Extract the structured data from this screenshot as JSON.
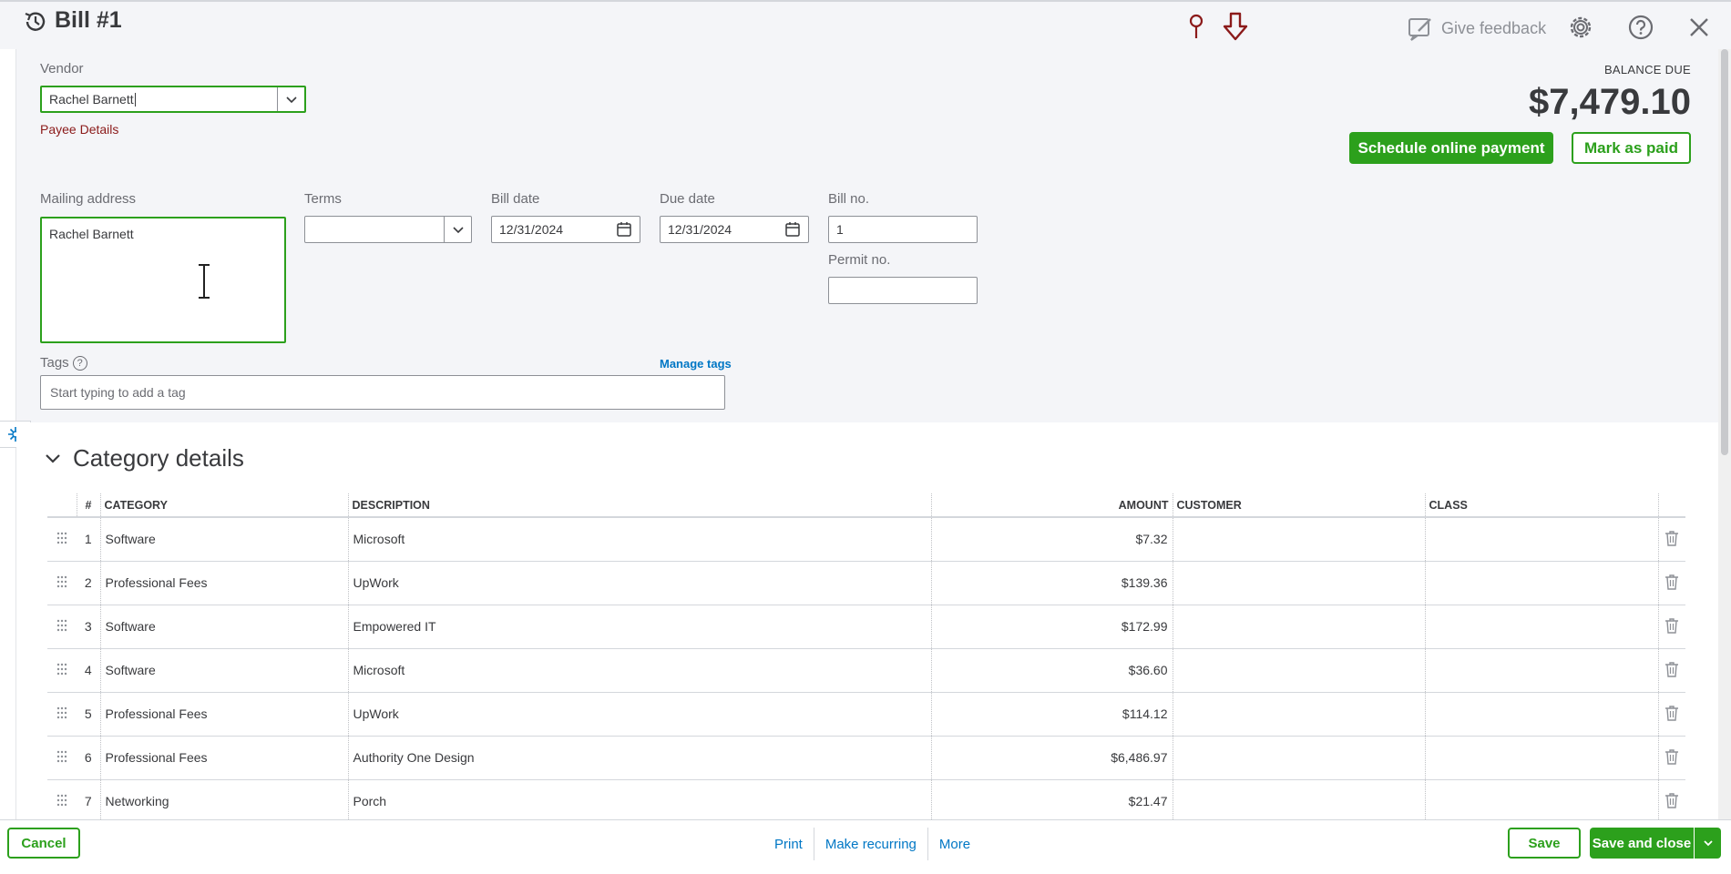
{
  "header": {
    "title": "Bill #1",
    "feedback_label": "Give feedback"
  },
  "vendor": {
    "label": "Vendor",
    "value": "Rachel Barnett",
    "payee_link": "Payee Details"
  },
  "balance": {
    "label": "BALANCE DUE",
    "amount": "$7,479.10",
    "schedule_label": "Schedule online payment",
    "mark_paid_label": "Mark as paid"
  },
  "fields": {
    "mailing_label": "Mailing address",
    "mailing_value": "Rachel Barnett",
    "terms_label": "Terms",
    "terms_value": "",
    "bill_date_label": "Bill date",
    "bill_date_value": "12/31/2024",
    "due_date_label": "Due date",
    "due_date_value": "12/31/2024",
    "bill_no_label": "Bill no.",
    "bill_no_value": "1",
    "permit_label": "Permit no.",
    "permit_value": ""
  },
  "tags": {
    "label": "Tags",
    "manage_label": "Manage tags",
    "placeholder": "Start typing to add a tag"
  },
  "category": {
    "title": "Category details",
    "columns": [
      "#",
      "CATEGORY",
      "DESCRIPTION",
      "AMOUNT",
      "CUSTOMER",
      "CLASS"
    ],
    "rows": [
      {
        "num": "1",
        "category": "Software",
        "description": "Microsoft",
        "amount": "$7.32"
      },
      {
        "num": "2",
        "category": "Professional Fees",
        "description": "UpWork",
        "amount": "$139.36"
      },
      {
        "num": "3",
        "category": "Software",
        "description": "Empowered IT",
        "amount": "$172.99"
      },
      {
        "num": "4",
        "category": "Software",
        "description": "Microsoft",
        "amount": "$36.60"
      },
      {
        "num": "5",
        "category": "Professional Fees",
        "description": "UpWork",
        "amount": "$114.12"
      },
      {
        "num": "6",
        "category": "Professional Fees",
        "description": "Authority One Design",
        "amount": "$6,486.97"
      },
      {
        "num": "7",
        "category": "Networking",
        "description": "Porch",
        "amount": "$21.47"
      }
    ]
  },
  "footer": {
    "cancel": "Cancel",
    "print": "Print",
    "make_recurring": "Make recurring",
    "more": "More",
    "save": "Save",
    "save_close": "Save and close"
  },
  "colors": {
    "accent_green": "#2ca01c",
    "link_blue": "#0077c5",
    "payee_red": "#8b1a1a"
  }
}
